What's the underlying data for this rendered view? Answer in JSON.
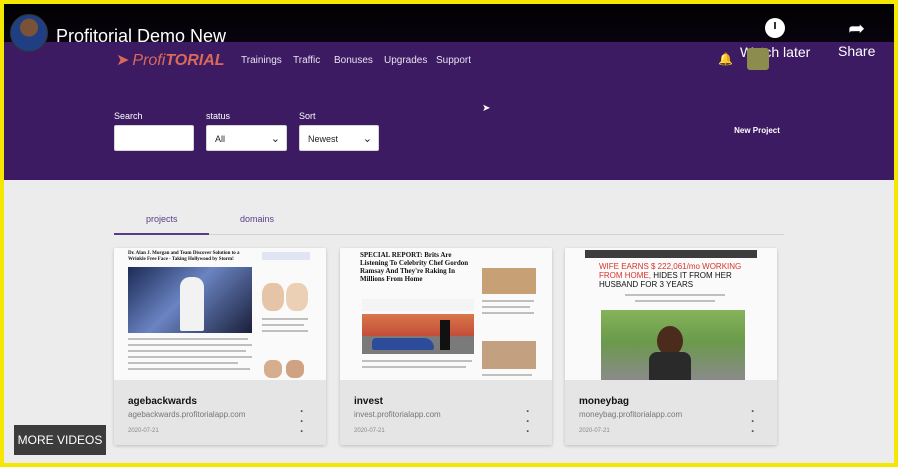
{
  "video": {
    "title": "Profitorial Demo New",
    "watch_later": "Watch later",
    "share": "Share",
    "more_videos": "MORE VIDEOS"
  },
  "app": {
    "logo_prefix": "Profi",
    "logo_suffix": "TORIAL",
    "nav": [
      "Trainings",
      "Traffic",
      "Bonuses",
      "Upgrades",
      "Support"
    ],
    "colors": {
      "header": "#3c1b63",
      "border": "#f5e700",
      "accent": "#d96a58"
    }
  },
  "filters": {
    "search_label": "Search",
    "search_value": "",
    "status_label": "status",
    "status_value": "All",
    "sort_label": "Sort",
    "sort_value": "Newest",
    "new_project": "New Project"
  },
  "tabs": [
    "projects",
    "domains"
  ],
  "projects": [
    {
      "name": "agebackwards",
      "url": "agebackwards.profitorialapp.com",
      "date": "2020-07-21",
      "preview_headline": "Dr. Alan J. Morgan and Team Discover Solution to a Wrinkle Free Face - Taking Hollywood by Storm!"
    },
    {
      "name": "invest",
      "url": "invest.profitorialapp.com",
      "date": "2020-07-21",
      "preview_headline": "SPECIAL REPORT: Brits Are Listening To Celebrity Chef Gordon Ramsay And They're Raking In Millions From Home"
    },
    {
      "name": "moneybag",
      "url": "moneybag.profitorialapp.com",
      "date": "2020-07-21",
      "preview_headline_red": "WIFE EARNS $ 222,061/mo WORKING FROM HOME,",
      "preview_headline_black": "HIDES IT FROM HER HUSBAND FOR 3 YEARS"
    }
  ]
}
